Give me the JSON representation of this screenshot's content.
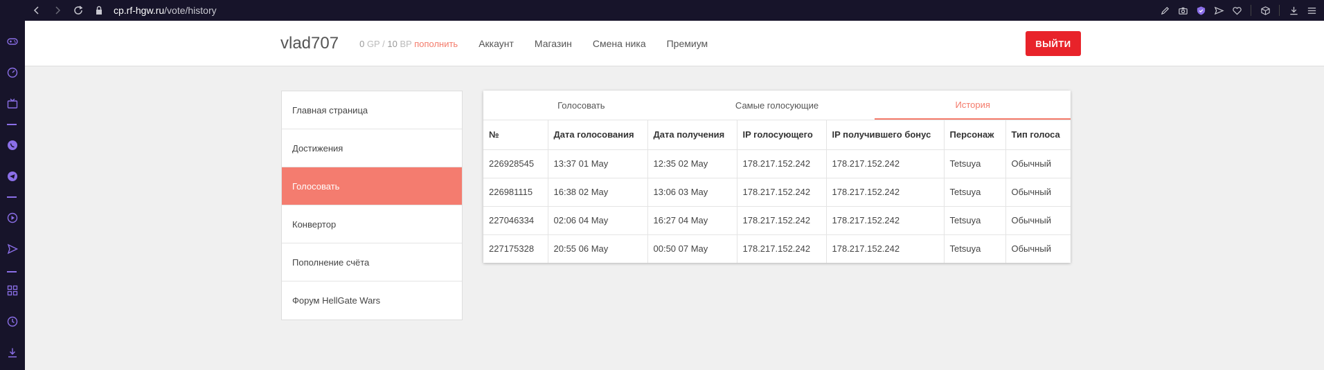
{
  "browser": {
    "url_host": "cp.rf-hgw.ru",
    "url_path": "/vote/history"
  },
  "header": {
    "username": "vlad707",
    "gp_value": "0",
    "gp_unit": "GP",
    "separator": "/",
    "bp_value": "10",
    "bp_unit": "BP",
    "topup_label": "пополнить",
    "nav": [
      "Аккаунт",
      "Магазин",
      "Смена ника",
      "Премиум"
    ],
    "logout_label": "ВЫЙТИ",
    "accent_color": "#e8232a"
  },
  "menu": {
    "items": [
      {
        "label": "Главная страница"
      },
      {
        "label": "Достижения"
      },
      {
        "label": "Голосовать"
      },
      {
        "label": "Конвертор"
      },
      {
        "label": "Пополнение счёта"
      },
      {
        "label": "Форум HellGate Wars"
      }
    ],
    "active_index": 2,
    "active_color": "#f47c6f"
  },
  "tabs": {
    "items": [
      "Голосовать",
      "Самые голосующие",
      "История"
    ],
    "active_index": 2
  },
  "table": {
    "columns": [
      "№",
      "Дата голосования",
      "Дата получения",
      "IP голосующего",
      "IP получившего бонус",
      "Персонаж",
      "Тип голоса"
    ],
    "rows": [
      [
        "226928545",
        "13:37 01 May",
        "12:35 02 May",
        "178.217.152.242",
        "178.217.152.242",
        "Tetsuya",
        "Обычный"
      ],
      [
        "226981115",
        "16:38 02 May",
        "13:06 03 May",
        "178.217.152.242",
        "178.217.152.242",
        "Tetsuya",
        "Обычный"
      ],
      [
        "227046334",
        "02:06 04 May",
        "16:27 04 May",
        "178.217.152.242",
        "178.217.152.242",
        "Tetsuya",
        "Обычный"
      ],
      [
        "227175328",
        "20:55 06 May",
        "00:50 07 May",
        "178.217.152.242",
        "178.217.152.242",
        "Tetsuya",
        "Обычный"
      ]
    ]
  }
}
